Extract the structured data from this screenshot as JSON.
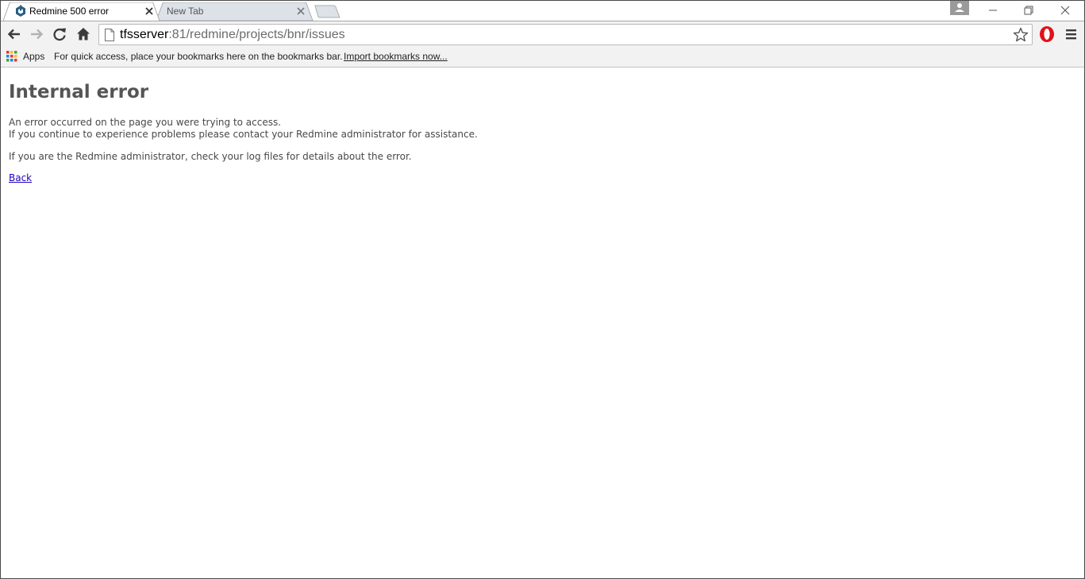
{
  "tabs": [
    {
      "title": "Redmine 500 error",
      "active": true,
      "favicon": "redmine-icon"
    },
    {
      "title": "New Tab",
      "active": false
    }
  ],
  "address_bar": {
    "host": "tfsserver",
    "rest": ":81/redmine/projects/bnr/issues"
  },
  "bookmarks_bar": {
    "apps_label": "Apps",
    "hint": "For quick access, place your bookmarks here on the bookmarks bar.",
    "import_link": "Import bookmarks now..."
  },
  "page": {
    "heading": "Internal error",
    "line1": "An error occurred on the page you were trying to access.",
    "line2": "If you continue to experience problems please contact your Redmine administrator for assistance.",
    "line3": "If you are the Redmine administrator, check your log files for details about the error.",
    "back_link": "Back"
  },
  "colors": {
    "link": "#2200c1",
    "opera_red": "#e0121a"
  }
}
